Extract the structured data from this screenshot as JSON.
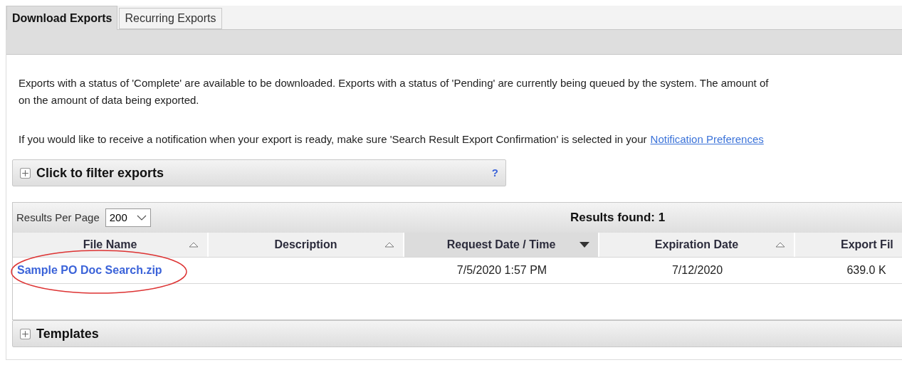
{
  "tabs": [
    {
      "label": "Download Exports",
      "selected": true
    },
    {
      "label": "Recurring Exports",
      "selected": false
    }
  ],
  "intro": {
    "lines": [
      "Exports with a status of 'Complete' are available to be downloaded. Exports with a status of 'Pending' are currently being queued by the system. The amount of",
      "on the amount of data being exported."
    ]
  },
  "notice": {
    "text": "If you would like to receive a notification when your export is ready, make sure 'Search Result Export Confirmation' is selected in your",
    "link": "Notification Preferences"
  },
  "filter_panel": {
    "title": "Click to filter exports",
    "expanded": false,
    "help": "?"
  },
  "results": {
    "per_page_label": "Results Per Page",
    "per_page": "200",
    "found": "Results found: 1",
    "columns": [
      {
        "label": "File Name",
        "sorted": false
      },
      {
        "label": "Description",
        "sorted": false
      },
      {
        "label": "Request Date / Time",
        "sorted": true
      },
      {
        "label": "Expiration Date",
        "sorted": false
      },
      {
        "label": "Export Fil"
      }
    ],
    "rows": [
      {
        "file": "Sample PO Doc Search.zip",
        "requested": "7/5/2020 1:57 PM",
        "expires": "7/12/2020",
        "size": "639.0 K",
        "circled": true
      }
    ]
  },
  "templates_panel": {
    "title": "Templates",
    "expanded": false
  }
}
